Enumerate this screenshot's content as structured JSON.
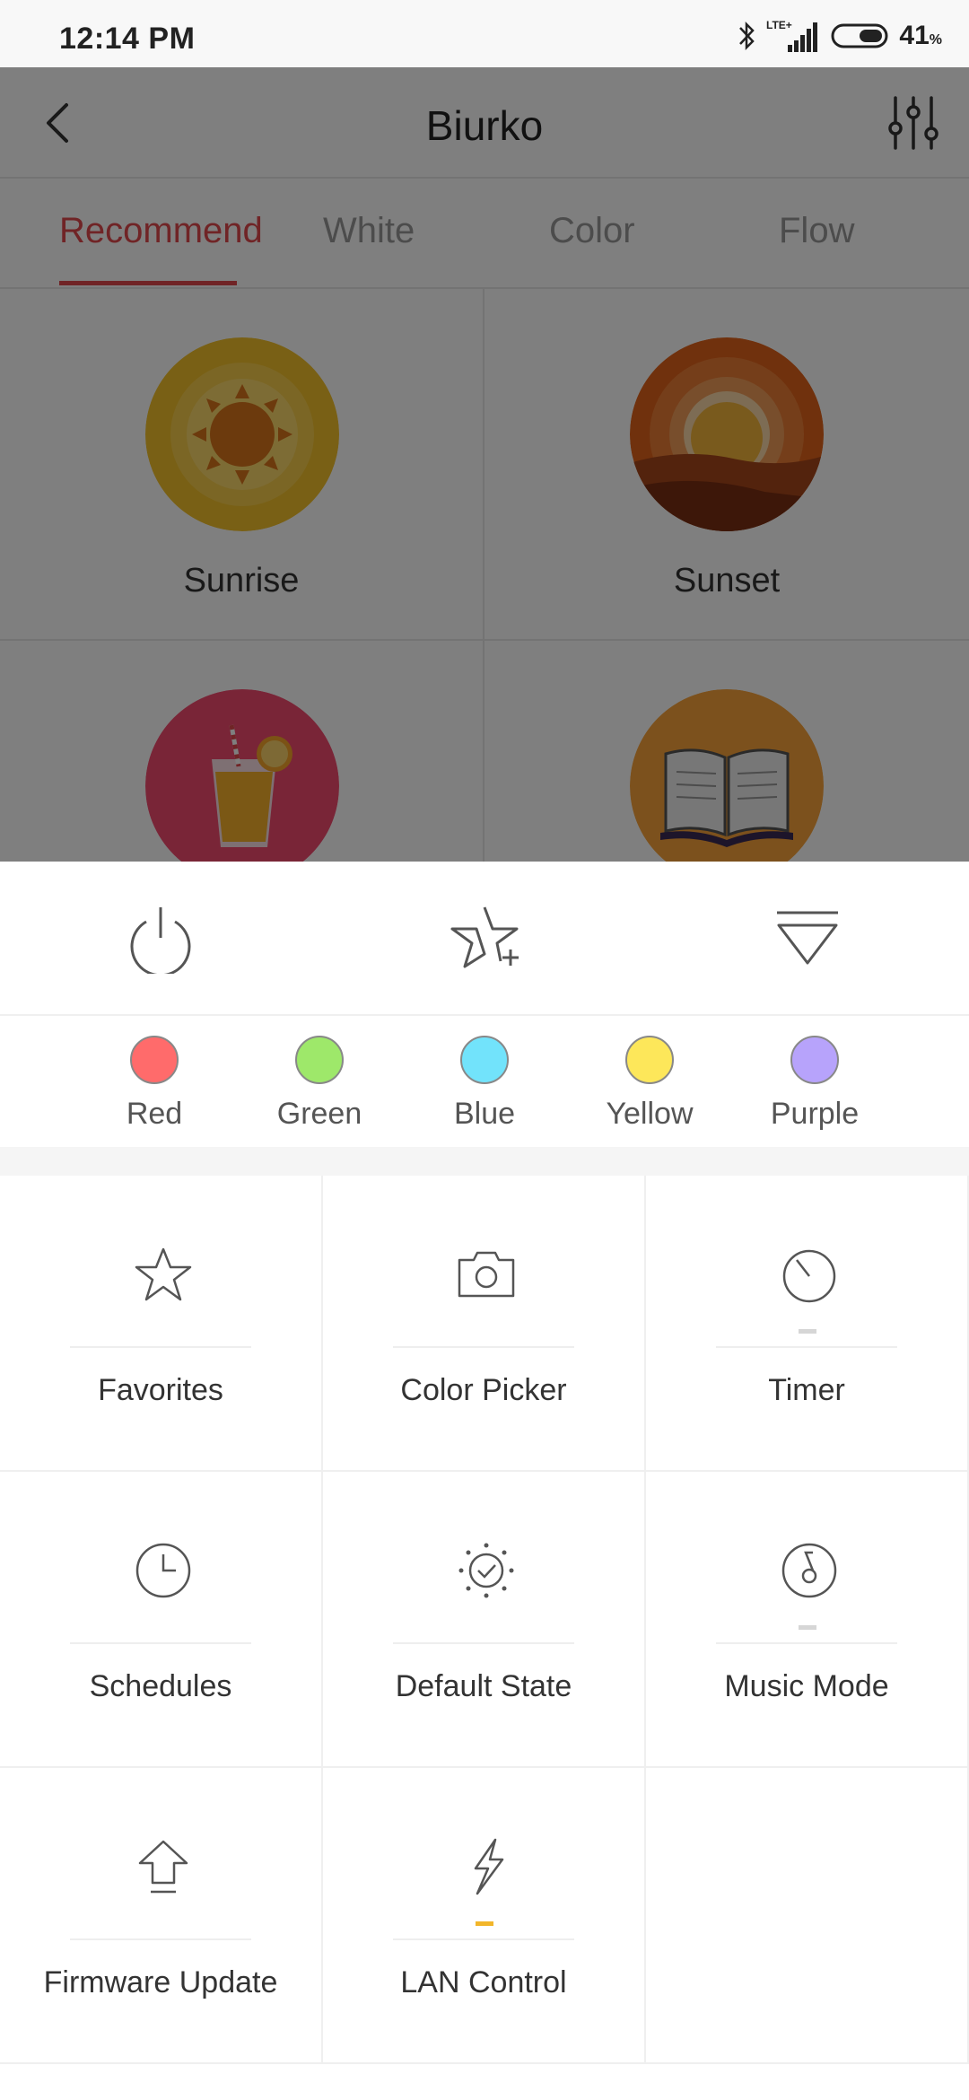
{
  "status_bar": {
    "time": "12:14 PM",
    "network": "LTE+",
    "battery_level": "41",
    "battery_unit": "%"
  },
  "header": {
    "title": "Biurko",
    "back_icon": "chevron-left-icon",
    "settings_icon": "sliders-icon"
  },
  "tabs": [
    {
      "label": "Recommend",
      "active": true
    },
    {
      "label": "White",
      "active": false
    },
    {
      "label": "Color",
      "active": false
    },
    {
      "label": "Flow",
      "active": false
    }
  ],
  "scenes": [
    {
      "label": "Sunrise",
      "icon": "sunrise-icon"
    },
    {
      "label": "Sunset",
      "icon": "sunset-icon"
    },
    {
      "label": "",
      "icon": "drink-icon"
    },
    {
      "label": "",
      "icon": "book-icon"
    }
  ],
  "quick_actions": [
    {
      "icon": "power-icon"
    },
    {
      "icon": "star-plus-icon"
    },
    {
      "icon": "collapse-icon"
    }
  ],
  "colors": [
    {
      "label": "Red",
      "color": "#ff6b6b"
    },
    {
      "label": "Green",
      "color": "#9ee86a"
    },
    {
      "label": "Blue",
      "color": "#72e3fb"
    },
    {
      "label": "Yellow",
      "color": "#fde75a"
    },
    {
      "label": "Purple",
      "color": "#b7a3fb"
    }
  ],
  "features": [
    {
      "label": "Favorites",
      "icon": "star-icon"
    },
    {
      "label": "Color Picker",
      "icon": "camera-icon"
    },
    {
      "label": "Timer",
      "icon": "timer-icon"
    },
    {
      "label": "Schedules",
      "icon": "clock-icon"
    },
    {
      "label": "Default State",
      "icon": "default-state-icon"
    },
    {
      "label": "Music Mode",
      "icon": "music-icon"
    },
    {
      "label": "Firmware Update",
      "icon": "upload-icon"
    },
    {
      "label": "LAN Control",
      "icon": "lightning-icon"
    }
  ],
  "theme": {
    "accent": "#e0484d",
    "lan_indicator": "#f2b62a"
  }
}
